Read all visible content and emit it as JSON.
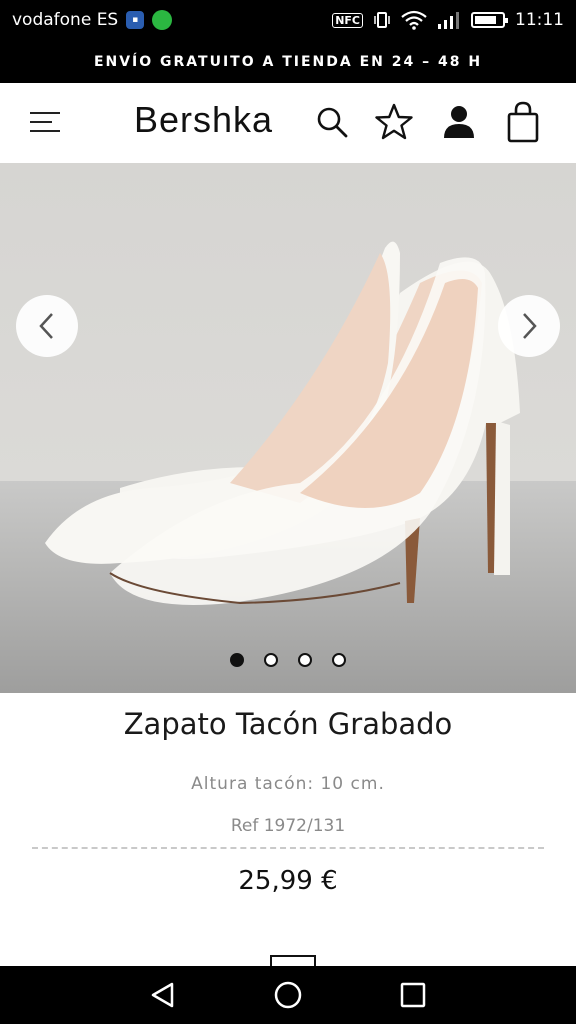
{
  "status_bar": {
    "carrier": "vodafone ES",
    "nfc": "NFC",
    "time": "11:11",
    "icons": [
      "sim-app-icon",
      "whatsapp-icon",
      "nfc-icon",
      "vibrate-icon",
      "wifi-icon",
      "signal-icon",
      "battery-icon"
    ]
  },
  "promo": {
    "text": "ENVÍO GRATUITO A TIENDA EN 24 – 48 H"
  },
  "header": {
    "brand": "Bershka",
    "icons": [
      "menu-icon",
      "search-icon",
      "star-icon",
      "user-icon",
      "bag-icon"
    ]
  },
  "gallery": {
    "slide_count": 4,
    "active_slide": 1
  },
  "product": {
    "name": "Zapato Tacón Grabado",
    "description": "Altura tacón: 10 cm.",
    "reference": "Ref 1972/131",
    "price": "25,99 €"
  },
  "navbar": {
    "icons": [
      "back-icon",
      "home-icon",
      "recents-icon"
    ]
  }
}
